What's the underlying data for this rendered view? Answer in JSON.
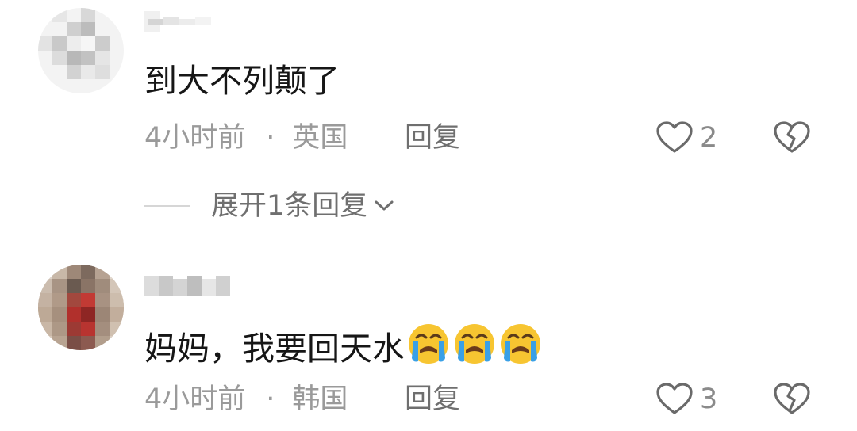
{
  "comments": [
    {
      "text": "到大不列颠了",
      "time": "4小时前",
      "separator": "·",
      "location": "英国",
      "reply_label": "回复",
      "likes": "2",
      "expand_label": "展开1条回复",
      "avatar_icon": "pixelated-avatar",
      "username_icon": "pixelated-username"
    },
    {
      "text": "妈妈，我要回天水",
      "emojis": [
        "loudly-crying-face",
        "loudly-crying-face",
        "loudly-crying-face"
      ],
      "time": "4小时前",
      "separator": "·",
      "location": "韩国",
      "reply_label": "回复",
      "likes": "3",
      "avatar_icon": "pixelated-avatar",
      "username_icon": "pixelated-username"
    }
  ],
  "colors": {
    "text_primary": "#161616",
    "text_secondary": "#9a9a9a",
    "action_text": "#6f6f6f",
    "icon_stroke": "#6a6a6a",
    "emoji_yellow": "#f7c531",
    "emoji_tear": "#3aa0e6"
  }
}
